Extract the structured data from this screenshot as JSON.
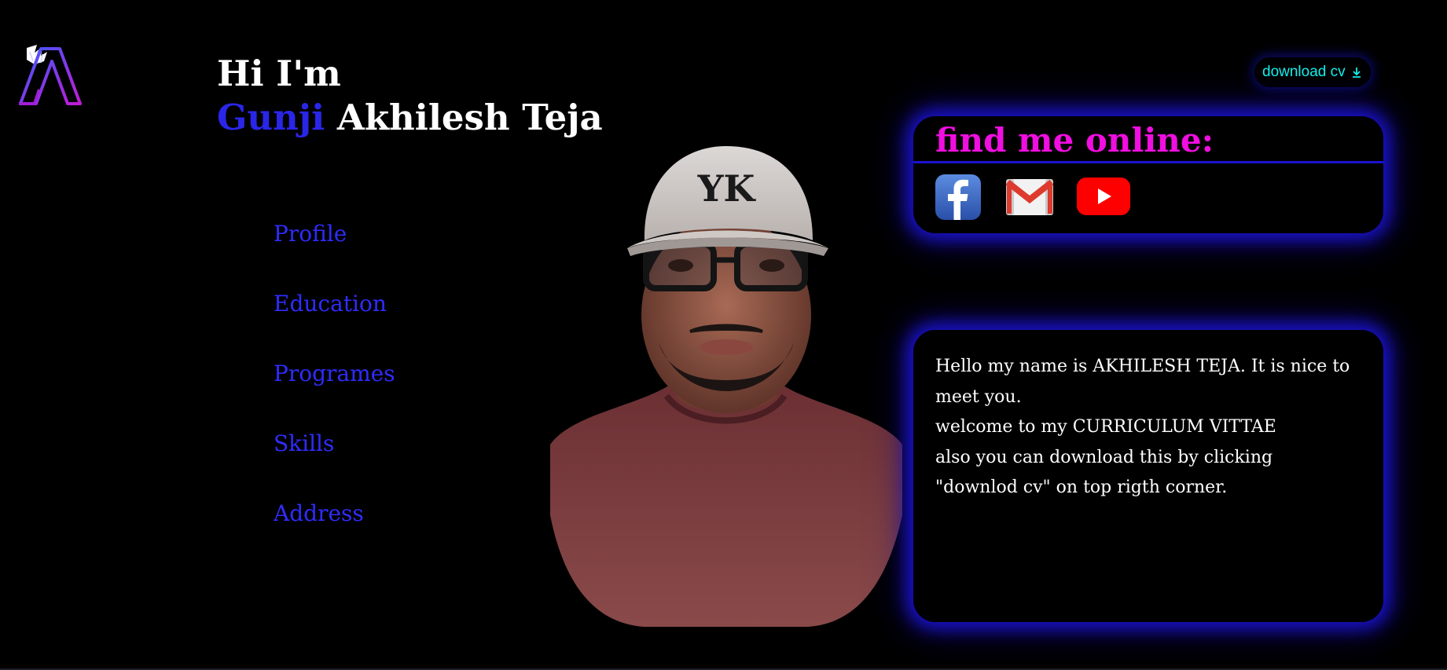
{
  "header": {
    "greeting_line1": "Hi I'm",
    "first_name": "Gunji",
    "last_name": " Akhilesh Teja"
  },
  "nav": {
    "items": [
      {
        "label": "Profile"
      },
      {
        "label": "Education"
      },
      {
        "label": "Programes"
      },
      {
        "label": "Skills"
      },
      {
        "label": "Address"
      }
    ]
  },
  "download": {
    "label": "download cv",
    "icon": "download-icon"
  },
  "find_me": {
    "title": "find me online:",
    "links": [
      {
        "icon": "facebook-icon"
      },
      {
        "icon": "gmail-icon"
      },
      {
        "icon": "youtube-icon"
      }
    ]
  },
  "about": {
    "lines": [
      "Hello my name is AKHILESH TEJA. It is nice to meet you.",
      "welcome to my CURRICULUM VITTAE",
      "also you can download this by clicking \"downlod cv\" on top rigth corner."
    ]
  },
  "colors": {
    "background": "#000000",
    "accent_blue": "#2a26e8",
    "title_magenta": "#f00ee0",
    "download_cyan": "#14f1ee",
    "glow": "#1a13cf"
  }
}
